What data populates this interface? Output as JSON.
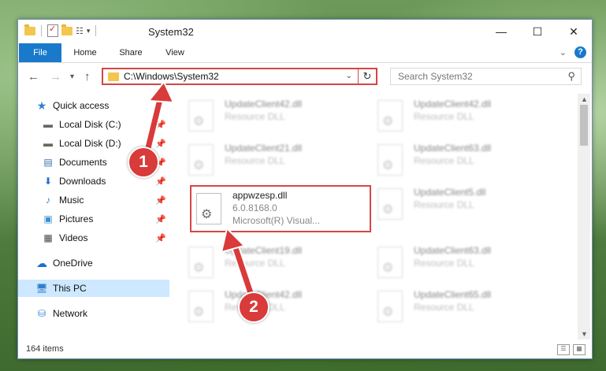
{
  "window": {
    "title": "System32",
    "controls": {
      "minimize": "—",
      "maximize": "☐",
      "close": "✕"
    }
  },
  "ribbon": {
    "tabs": [
      {
        "label": "File"
      },
      {
        "label": "Home"
      },
      {
        "label": "Share"
      },
      {
        "label": "View"
      }
    ]
  },
  "nav": {
    "address": "C:\\Windows\\System32",
    "search_placeholder": "Search System32"
  },
  "sidebar": {
    "items": [
      {
        "label": "Quick access",
        "icon": "star-icon"
      },
      {
        "label": "Local Disk (C:)",
        "icon": "drive-icon",
        "pinned": true
      },
      {
        "label": "Local Disk (D:)",
        "icon": "drive-icon",
        "pinned": true
      },
      {
        "label": "Documents",
        "icon": "documents-icon",
        "pinned": true
      },
      {
        "label": "Downloads",
        "icon": "downloads-icon",
        "pinned": true
      },
      {
        "label": "Music",
        "icon": "music-icon",
        "pinned": true
      },
      {
        "label": "Pictures",
        "icon": "pictures-icon",
        "pinned": true
      },
      {
        "label": "Videos",
        "icon": "videos-icon",
        "pinned": true
      },
      {
        "label": "OneDrive",
        "icon": "onedrive-icon"
      },
      {
        "label": "This PC",
        "icon": "pc-icon",
        "selected": true
      },
      {
        "label": "Network",
        "icon": "network-icon"
      }
    ]
  },
  "files": [
    {
      "name": "UpdateClient42.dll",
      "type": "Resource DLL"
    },
    {
      "name": "UpdateClient42.dll",
      "type": "Resource DLL"
    },
    {
      "name": "UpdateClient21.dll",
      "type": "Resource DLL"
    },
    {
      "name": "UpdateClient63.dll",
      "type": "Resource DLL"
    },
    {
      "name": "appwzesp.dll",
      "version": "6.0.8168.0",
      "company": "Microsoft(R) Visual..."
    },
    {
      "name": "UpdateClient5.dll",
      "type": "Resource DLL"
    },
    {
      "name": "UpdateClient19.dll",
      "type": "Resource DLL"
    },
    {
      "name": "UpdateClient63.dll",
      "type": "Resource DLL"
    },
    {
      "name": "UpdateClient42.dll",
      "type": "Resource DLL"
    },
    {
      "name": "UpdateClient65.dll",
      "type": "Resource DLL"
    }
  ],
  "status": {
    "item_count": "164 items"
  },
  "annotations": {
    "step1": "1",
    "step2": "2"
  },
  "colors": {
    "accent": "#1979ca",
    "highlight": "#d64545",
    "selected": "#cde8ff"
  }
}
